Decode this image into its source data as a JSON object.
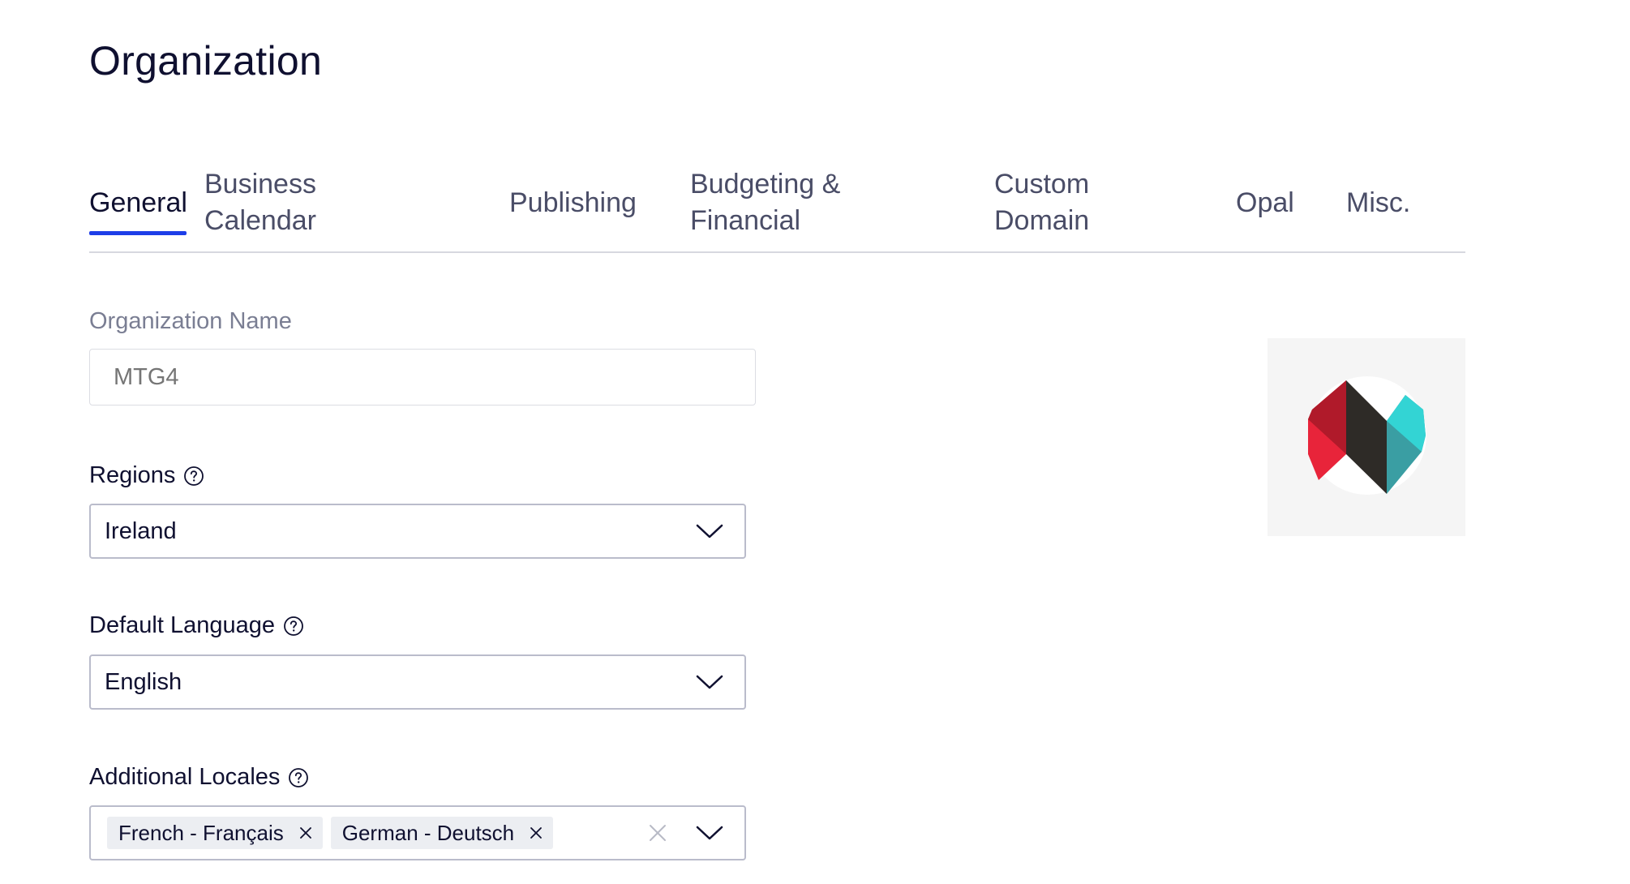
{
  "page": {
    "title": "Organization"
  },
  "tabs": [
    {
      "label": "General",
      "active": true
    },
    {
      "label": "Business\nCalendar",
      "active": false
    },
    {
      "label": "Publishing",
      "active": false
    },
    {
      "label": "Budgeting &\nFinancial",
      "active": false
    },
    {
      "label": "Custom\nDomain",
      "active": false
    },
    {
      "label": "Opal",
      "active": false
    },
    {
      "label": "Misc.",
      "active": false
    }
  ],
  "form": {
    "org_name": {
      "label": "Organization Name",
      "placeholder": "MTG4",
      "value": ""
    },
    "regions": {
      "label": "Regions",
      "value": "Ireland"
    },
    "default_language": {
      "label": "Default Language",
      "value": "English"
    },
    "additional_locales": {
      "label": "Additional Locales",
      "tags": [
        "French - Français",
        "German - Deutsch"
      ]
    }
  },
  "icons": {
    "help": "help-circle-icon",
    "chevron": "chevron-down-icon",
    "tag_remove": "close-icon",
    "clear": "clear-icon"
  },
  "colors": {
    "accent": "#1d3ee8",
    "logo_red_dark": "#b01a2a",
    "logo_red": "#e8243a",
    "logo_black": "#2e2b27",
    "logo_teal": "#33d4d4",
    "logo_teal_dark": "#3a9ea3"
  }
}
